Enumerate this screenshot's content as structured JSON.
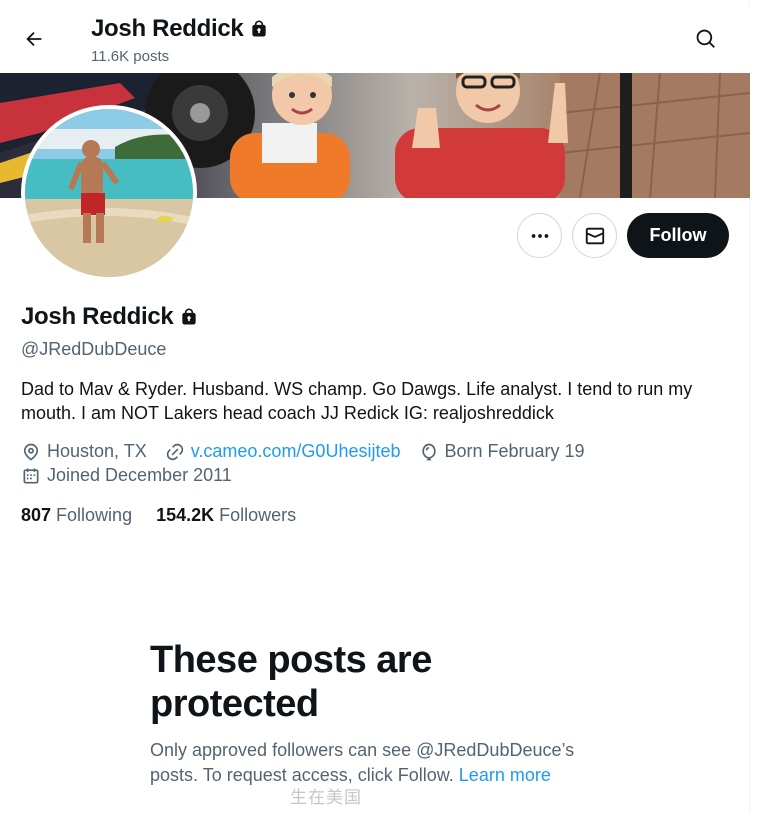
{
  "header": {
    "name": "Josh Reddick",
    "posts_count": "11.6K posts",
    "lock_icon": "lock-icon",
    "back_icon": "arrow-left-icon",
    "search_icon": "search-icon"
  },
  "profile": {
    "name": "Josh Reddick",
    "handle": "@JRedDubDeuce",
    "bio": "Dad to Mav & Ryder. Husband. WS champ.  Go Dawgs. Life analyst. I tend to run my mouth. I am NOT Lakers head coach JJ Redick IG: realjoshreddick",
    "location": "Houston, TX",
    "website": "v.cameo.com/G0Uhesijteb",
    "birthday": "Born February 19",
    "joined": "Joined December 2011",
    "following_count": "807",
    "following_label": "Following",
    "followers_count": "154.2K",
    "followers_label": "Followers"
  },
  "actions": {
    "more_icon": "more-dots-icon",
    "message_icon": "envelope-icon",
    "follow_label": "Follow"
  },
  "protected": {
    "title": "These posts are protected",
    "text": "Only approved followers can see @JRedDubDeuce’s posts. To request access, click Follow.",
    "learn_more": "Learn more"
  },
  "watermark": "生在美国",
  "colors": {
    "text_primary": "#0f1419",
    "text_secondary": "#536471",
    "link": "#1d9bf0",
    "follow_bg": "#0f1419",
    "border": "#cfd9de"
  }
}
